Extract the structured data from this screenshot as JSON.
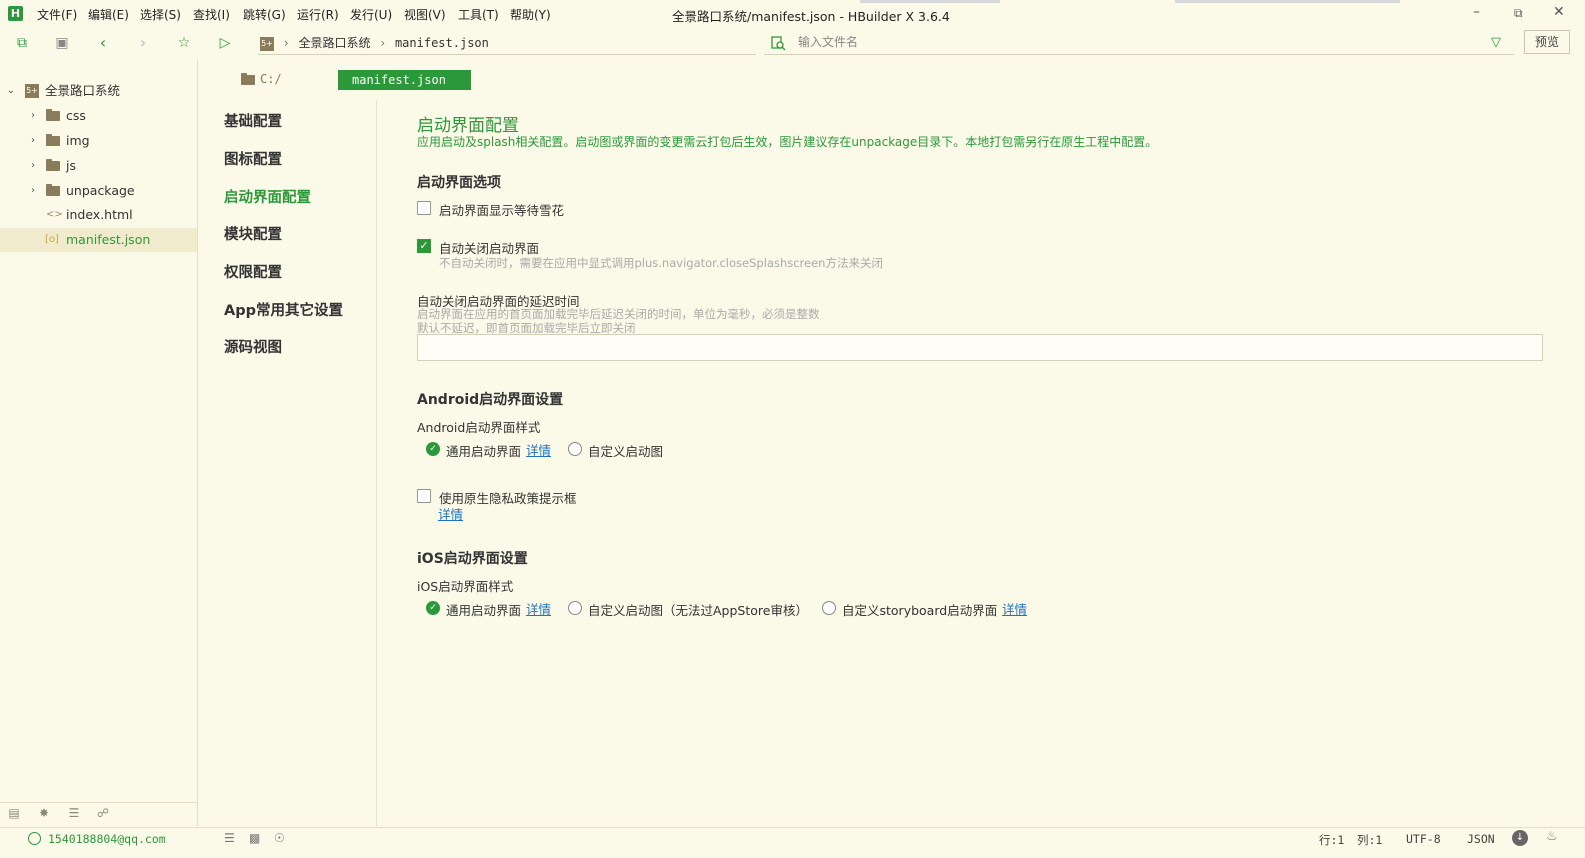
{
  "menu": {
    "items": [
      "文件(F)",
      "编辑(E)",
      "选择(S)",
      "查找(I)",
      "跳转(G)",
      "运行(R)",
      "发行(U)",
      "视图(V)",
      "工具(T)",
      "帮助(Y)"
    ],
    "window_title": "全景路口系统/manifest.json - HBuilder X 3.6.4"
  },
  "toolbar": {
    "breadcrumb": [
      "全景路口系统",
      "manifest.json"
    ],
    "search_placeholder": "输入文件名",
    "preview_label": "预览"
  },
  "tree": {
    "project": "全景路口系统",
    "items": [
      {
        "label": "css",
        "type": "folder"
      },
      {
        "label": "img",
        "type": "folder"
      },
      {
        "label": "js",
        "type": "folder"
      },
      {
        "label": "unpackage",
        "type": "folder"
      },
      {
        "label": "index.html",
        "type": "html"
      },
      {
        "label": "manifest.json",
        "type": "json",
        "selected": true
      }
    ]
  },
  "editor": {
    "path": "C:/",
    "tab": "manifest.json"
  },
  "config_nav": [
    "基础配置",
    "图标配置",
    "启动界面配置",
    "模块配置",
    "权限配置",
    "App常用其它设置",
    "源码视图"
  ],
  "content": {
    "title": "启动界面配置",
    "subtitle": "应用启动及splash相关配置。启动图或界面的变更需云打包后生效，图片建议存在unpackage目录下。本地打包需另行在原生工程中配置。",
    "options_title": "启动界面选项",
    "show_snow_label": "启动界面显示等待雪花",
    "auto_close_label": "自动关闭启动界面",
    "auto_close_hint": "不自动关闭时，需要在应用中显式调用plus.navigator.closeSplashscreen方法来关闭",
    "delay_title": "自动关闭启动界面的延迟时间",
    "delay_hint1": "启动界面在应用的首页面加载完毕后延迟关闭的时间，单位为毫秒，必须是整数",
    "delay_hint2": "默认不延迟，即首页面加载完毕后立即关闭",
    "delay_value": "",
    "android_title": "Android启动界面设置",
    "android_style_label": "Android启动界面样式",
    "android_opt_common": "通用启动界面",
    "android_opt_custom": "自定义启动图",
    "detail": "详情",
    "privacy_label": "使用原生隐私政策提示框",
    "ios_title": "iOS启动界面设置",
    "ios_style_label": "iOS启动界面样式",
    "ios_opt_common": "通用启动界面",
    "ios_opt_custom": "自定义启动图（无法过AppStore审核）",
    "ios_opt_storyboard": "自定义storyboard启动界面"
  },
  "status": {
    "email": "1540188804@qq.com",
    "line": "行:1",
    "col": "列:1",
    "encoding": "UTF-8",
    "syntax": "JSON"
  },
  "colors": {
    "accent": "#2b9939",
    "background": "#fbf9e8",
    "link": "#1a73c8"
  }
}
